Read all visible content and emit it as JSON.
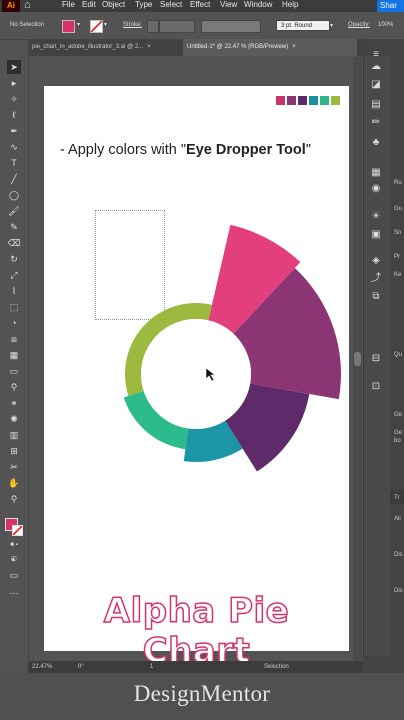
{
  "menubar": {
    "logo": "Ai",
    "items": [
      "File",
      "Edit",
      "Object",
      "Type",
      "Select",
      "Effect",
      "View",
      "Window",
      "Help"
    ],
    "share": "Shar"
  },
  "control_bar": {
    "selection_label": "No Selection",
    "stroke_label": "Stroke:",
    "stroke_style": "3 pt. Round",
    "opacity_label": "Opacity:",
    "opacity_value": "100%",
    "fill_color": "#d6336c"
  },
  "tabs": [
    {
      "label": "pie_chart_in_adobe_illustrator_3.ai @ 2..."
    },
    {
      "label": "Untitled-1* @ 22.47 % (RGB/Preview)"
    }
  ],
  "artboard": {
    "heading_prefix": "- Apply colors with \"",
    "heading_bold": "Eye Dropper Tool",
    "heading_suffix": "\"",
    "title": "Alpha Pie Chart",
    "palette": [
      "#c9336e",
      "#8a3572",
      "#5e2a6b",
      "#1b8fa0",
      "#2ab58a",
      "#9bbb3a"
    ]
  },
  "chart_data": {
    "type": "pie",
    "subtype": "radial-donut",
    "segments": [
      {
        "color": "#e33f7d",
        "start_deg": 13,
        "end_deg": 43,
        "outer_radius": 153
      },
      {
        "color": "#8b3575",
        "start_deg": 43,
        "end_deg": 100,
        "outer_radius": 145
      },
      {
        "color": "#5f2a6a",
        "start_deg": 100,
        "end_deg": 148,
        "outer_radius": 115
      },
      {
        "color": "#1a96a6",
        "start_deg": 148,
        "end_deg": 188,
        "outer_radius": 88
      },
      {
        "color": "#2cbb8c",
        "start_deg": 188,
        "end_deg": 252,
        "outer_radius": 76
      },
      {
        "color": "#9ab93e",
        "start_deg": 252,
        "end_deg": 373,
        "outer_radius": 71
      }
    ],
    "inner_radius": 55
  },
  "status_bar": {
    "zoom": "22.47%",
    "angle": "0°",
    "page": "1",
    "tool": "Selection"
  },
  "right_panel_labels": [
    "Ru",
    "Gu",
    "Sn",
    "Pr",
    "Ke",
    "Qu",
    "Ge",
    "Ge",
    "bo",
    "Tr",
    "Ali",
    "Dis",
    "Dis"
  ],
  "watermark": "DesignMentor"
}
